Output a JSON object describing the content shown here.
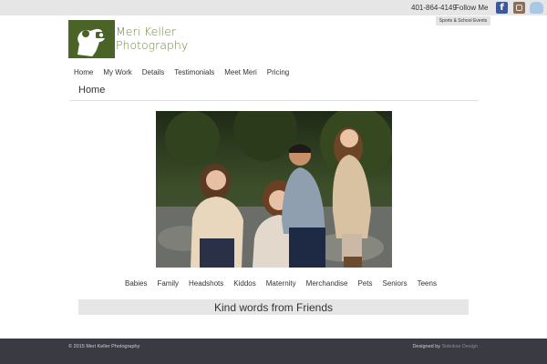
{
  "topbar": {
    "phone": "401-864-4149",
    "follow_label": "Follow Me",
    "icons": [
      "facebook-icon",
      "instagram-icon",
      "cloud-icon"
    ],
    "tooltip": "Sports & School Events"
  },
  "brand": {
    "line1": "Meri Keller",
    "line2": "Photography",
    "accent": "#4a6427"
  },
  "nav": {
    "items": [
      "Home",
      "My Work",
      "Details",
      "Testimonials",
      "Meet Meri",
      "Pricing"
    ]
  },
  "page": {
    "title": "Home"
  },
  "categories": [
    "Babies",
    "Family",
    "Headshots",
    "Kiddos",
    "Maternity",
    "Merchandise",
    "Pets",
    "Seniors",
    "Teens"
  ],
  "kind_words": "Kind words from Friends",
  "footer": {
    "copyright": "© 2015 Meri Keller Photography",
    "designed_by": "Designed by",
    "designer": "Sideless Design"
  }
}
